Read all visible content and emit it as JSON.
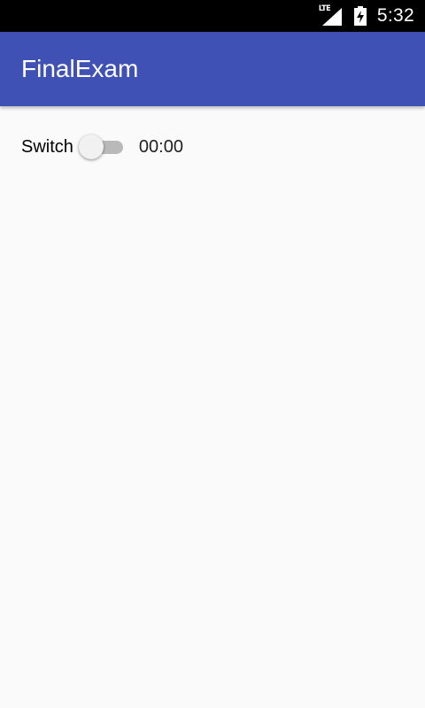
{
  "status_bar": {
    "network": "LTE",
    "time": "5:32"
  },
  "app_bar": {
    "title": "FinalExam"
  },
  "main": {
    "switch_label": "Switch",
    "switch_state": "off",
    "timer": "00:00"
  },
  "colors": {
    "primary": "#3f51b5",
    "status_bar": "#000000",
    "background": "#fafafa"
  }
}
